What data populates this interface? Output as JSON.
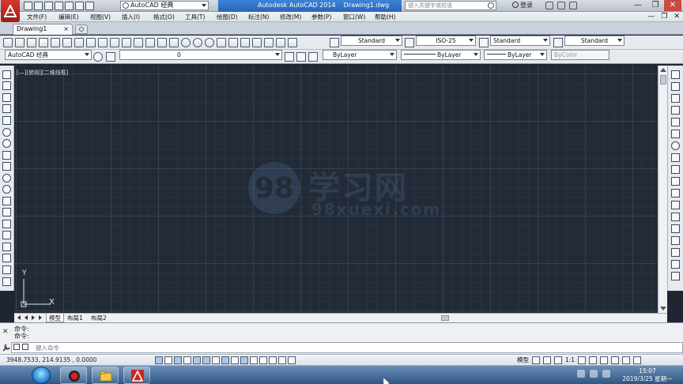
{
  "window": {
    "title_app": "Autodesk AutoCAD 2014",
    "title_doc": "Drawing1.dwg",
    "workspace": "AutoCAD 经典",
    "help_search_placeholder": "键入关键字或短语",
    "login_label": "登录",
    "minimize_glyph": "—",
    "restore_glyph": "❐",
    "close_glyph": "✕"
  },
  "menu": {
    "items": [
      "文件(F)",
      "编辑(E)",
      "视图(V)",
      "插入(I)",
      "格式(O)",
      "工具(T)",
      "绘图(D)",
      "标注(N)",
      "修改(M)",
      "参数(P)",
      "窗口(W)",
      "帮助(H)"
    ],
    "mdi_min": "—",
    "mdi_restore": "❐",
    "mdi_close": "✕"
  },
  "tabs": {
    "document": "Drawing1",
    "document_close": "×"
  },
  "styles_toolbar": {
    "text_style": "Standard",
    "dim_style": "ISO-25",
    "table_style": "Standard",
    "mleader_style": "Standard"
  },
  "layers_toolbar": {
    "workspace": "AutoCAD 经典",
    "current_layer": "0",
    "color": "ByLayer",
    "linetype": "ByLayer",
    "lineweight": "ByLayer",
    "plot_style": "ByColor"
  },
  "canvas": {
    "viewport_label": "[—][俯视][二维线框]",
    "background_color": "#222a36",
    "ucs_y": "Y",
    "ucs_x": "X",
    "watermark_logo": "98",
    "watermark_cn": "学习网",
    "watermark_en": "98xuexi.com"
  },
  "layout_tabs": [
    "模型",
    "布局1",
    "布局2"
  ],
  "command": {
    "history": [
      "命令:",
      "命令:"
    ],
    "placeholder": "键入命令"
  },
  "status": {
    "coords": "3948.7533, 214.9135 , 0.0000",
    "model_label": "模型",
    "annotation_scale": "1:1"
  },
  "taskbar": {
    "time": "15:07",
    "date": "2019/3/25 星期一"
  }
}
